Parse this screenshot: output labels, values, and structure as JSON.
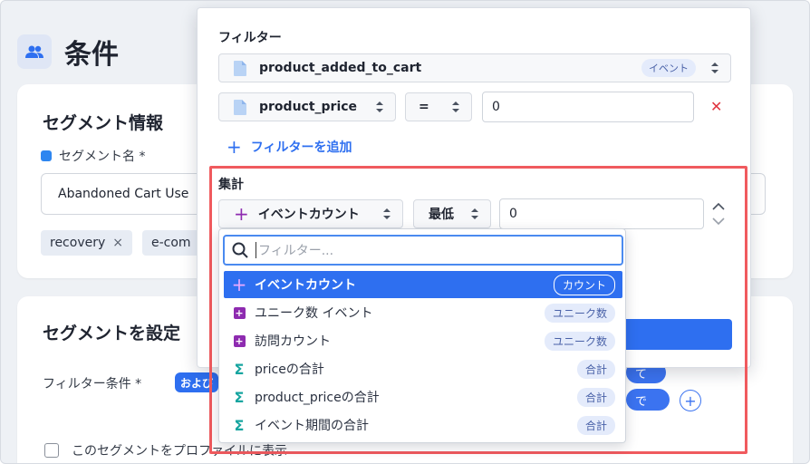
{
  "page": {
    "title": "条件"
  },
  "segment_info": {
    "title": "セグメント情報",
    "name_label": "セグメント名 *",
    "name_value": "Abandoned Cart Use",
    "tags": [
      "recovery",
      "e-com"
    ],
    "tag_remove_glyph": "×"
  },
  "segment_settings": {
    "title": "セグメントを設定",
    "filter_condition_label": "フィルター条件 *",
    "and_pill": "および",
    "pill_right_1": "て",
    "pill_right_2": "で",
    "add_glyph": "+",
    "show_on_profile_label": "このセグメントをプロファイルに表示"
  },
  "popover": {
    "filter_section_label": "フィルター",
    "event_select": {
      "value": "product_added_to_cart",
      "badge": "イベント"
    },
    "property_select": {
      "value": "product_price"
    },
    "operator_select": {
      "value": "="
    },
    "value_input": "0",
    "remove_glyph": "✕",
    "add_filter_label": "フィルターを追加",
    "add_glyph": "+",
    "aggregate_section_label": "集計",
    "aggregate_select": {
      "value": "イベントカウント"
    },
    "min_select": {
      "value": "最低"
    },
    "aggregate_value": "0"
  },
  "dropdown": {
    "search_placeholder": "フィルター...",
    "items": [
      {
        "label": "イベントカウント",
        "badge": "カウント",
        "icon": "plus-icon",
        "icon_glyph": "+",
        "active": true
      },
      {
        "label": "ユニーク数 イベント",
        "badge": "ユニーク数",
        "icon": "unique-square-icon",
        "icon_glyph": "+",
        "active": false
      },
      {
        "label": "訪問カウント",
        "badge": "ユニーク数",
        "icon": "unique-square-icon",
        "icon_glyph": "+",
        "active": false
      },
      {
        "label": "priceの合計",
        "badge": "合計",
        "icon": "sigma-icon",
        "icon_glyph": "Σ",
        "active": false
      },
      {
        "label": "product_priceの合計",
        "badge": "合計",
        "icon": "sigma-icon",
        "icon_glyph": "Σ",
        "active": false
      },
      {
        "label": "イベント期間の合計",
        "badge": "合計",
        "icon": "sigma-icon",
        "icon_glyph": "Σ",
        "active": false
      }
    ]
  },
  "colors": {
    "accent": "#2e6ff0",
    "highlight_border": "#f05a5e",
    "remove": "#e0343f",
    "unique_icon": "#8e2bb0",
    "sigma_icon": "#17a5a0"
  }
}
